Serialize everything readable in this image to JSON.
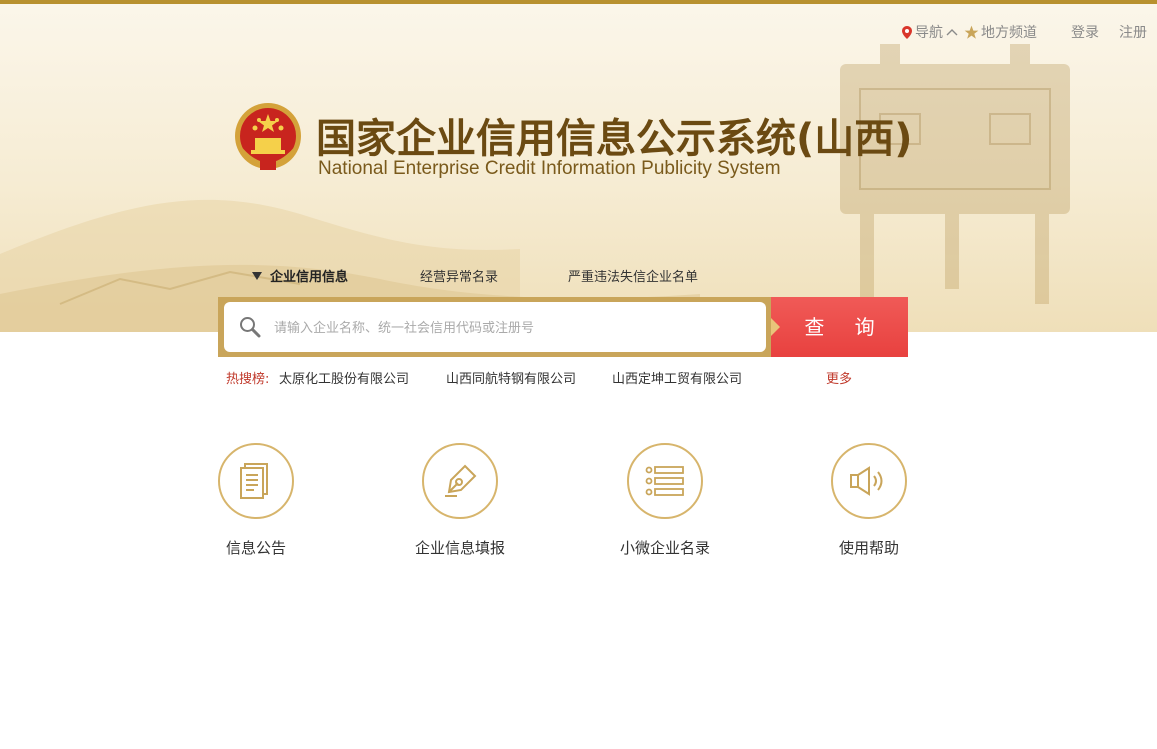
{
  "topnav": {
    "nav_label": "导航",
    "local_label": "地方频道",
    "login_label": "登录",
    "register_label": "注册"
  },
  "brand": {
    "title_cn": "国家企业信用信息公示系统(山西)",
    "title_en": "National Enterprise Credit Information Publicity System",
    "accent_color": "#b8912f"
  },
  "tabs": [
    {
      "label": "企业信用信息",
      "active": true
    },
    {
      "label": "经营异常名录",
      "active": false
    },
    {
      "label": "严重违法失信企业名单",
      "active": false
    }
  ],
  "search": {
    "placeholder": "请输入企业名称、统一社会信用代码或注册号",
    "value": "",
    "button_label": "查 询",
    "button_color": "#e8413f"
  },
  "hot": {
    "label": "热搜榜:",
    "items": [
      "太原化工股份有限公司",
      "山西同航特钢有限公司",
      "山西定坤工贸有限公司"
    ],
    "more_label": "更多"
  },
  "features": [
    {
      "label": "信息公告",
      "icon": "document-icon"
    },
    {
      "label": "企业信息填报",
      "icon": "pen-icon"
    },
    {
      "label": "小微企业名录",
      "icon": "list-icon"
    },
    {
      "label": "使用帮助",
      "icon": "speaker-icon"
    }
  ]
}
